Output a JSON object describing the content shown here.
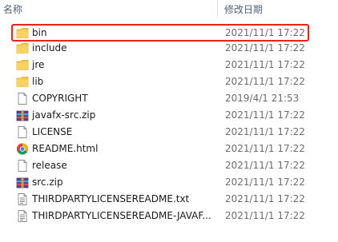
{
  "header": {
    "name_label": "名称",
    "date_label": "修改日期"
  },
  "files": [
    {
      "name": "bin",
      "date": "2021/11/1 17:22",
      "icon": "folder-icon"
    },
    {
      "name": "include",
      "date": "2021/11/1 17:22",
      "icon": "folder-icon"
    },
    {
      "name": "jre",
      "date": "2021/11/1 17:22",
      "icon": "folder-icon"
    },
    {
      "name": "lib",
      "date": "2021/11/1 17:22",
      "icon": "folder-icon"
    },
    {
      "name": "COPYRIGHT",
      "date": "2019/4/1 21:53",
      "icon": "document-icon"
    },
    {
      "name": "javafx-src.zip",
      "date": "2021/11/1 17:22",
      "icon": "archive-icon"
    },
    {
      "name": "LICENSE",
      "date": "2021/11/1 17:22",
      "icon": "document-icon"
    },
    {
      "name": "README.html",
      "date": "2021/11/1 17:22",
      "icon": "chrome-icon"
    },
    {
      "name": "release",
      "date": "2021/11/1 17:22",
      "icon": "document-icon"
    },
    {
      "name": "src.zip",
      "date": "2021/11/1 17:22",
      "icon": "archive-icon"
    },
    {
      "name": "THIRDPARTYLICENSEREADME.txt",
      "date": "2021/11/1 17:22",
      "icon": "text-file-icon"
    },
    {
      "name": "THIRDPARTYLICENSEREADME-JAVAF...",
      "date": "2021/11/1 17:22",
      "icon": "text-file-icon"
    }
  ],
  "highlight_color": "#e8231c",
  "folder_color": "#f5c84c"
}
